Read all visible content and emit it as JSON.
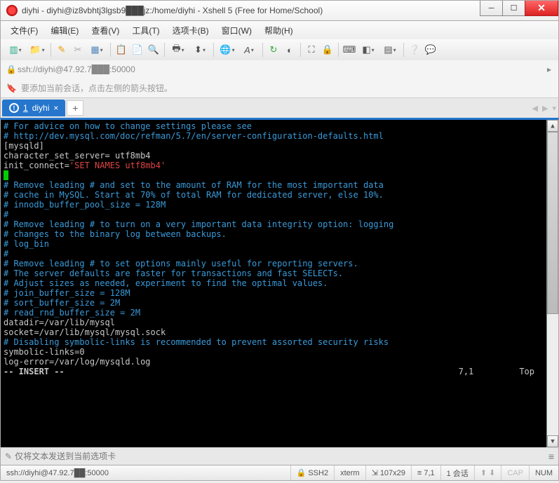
{
  "window": {
    "title": "diyhi - diyhi@iz8vbhtj3lgsb9███jz:/home/diyhi - Xshell 5 (Free for Home/School)"
  },
  "menu": {
    "file": "文件(F)",
    "edit": "编辑(E)",
    "view": "查看(V)",
    "tools": "工具(T)",
    "tabs": "选项卡(B)",
    "window": "窗口(W)",
    "help": "帮助(H)"
  },
  "address": {
    "value": "ssh://diyhi@47.92.7███:50000"
  },
  "hint": {
    "text": "要添加当前会话，点击左侧的箭头按钮。"
  },
  "tab": {
    "num": "1",
    "name": "diyhi"
  },
  "term": {
    "l1": "# For advice on how to change settings please see",
    "l2": "# http://dev.mysql.com/doc/refman/5.7/en/server-configuration-defaults.html",
    "l3": "",
    "l4": "[mysqld]",
    "l5": "character_set_server= utf8mb4",
    "l6a": "init_connect=",
    "l6b": "'SET NAMES utf8mb4'",
    "l7": "#",
    "l8": "# Remove leading # and set to the amount of RAM for the most important data",
    "l9": "# cache in MySQL. Start at 70% of total RAM for dedicated server, else 10%.",
    "l10": "# innodb_buffer_pool_size = 128M",
    "l11": "#",
    "l12": "# Remove leading # to turn on a very important data integrity option: logging",
    "l13": "# changes to the binary log between backups.",
    "l14": "# log_bin",
    "l15": "#",
    "l16": "# Remove leading # to set options mainly useful for reporting servers.",
    "l17": "# The server defaults are faster for transactions and fast SELECTs.",
    "l18": "# Adjust sizes as needed, experiment to find the optimal values.",
    "l19": "# join_buffer_size = 128M",
    "l20": "# sort_buffer_size = 2M",
    "l21": "# read_rnd_buffer_size = 2M",
    "l22": "datadir=/var/lib/mysql",
    "l23": "socket=/var/lib/mysql/mysql.sock",
    "l24": "",
    "l25": "# Disabling symbolic-links is recommended to prevent assorted security risks",
    "l26": "symbolic-links=0",
    "l27": "",
    "l28": "log-error=/var/log/mysqld.log",
    "l29a": "-- INSERT --",
    "l29b": "7,1",
    "l29c": "Top"
  },
  "input": {
    "placeholder": "仅将文本发送到当前选项卡"
  },
  "status": {
    "conn": "ssh://diyhi@47.92.7██:50000",
    "ssh": "SSH2",
    "term": "xterm",
    "size": "107x29",
    "pos": "7,1",
    "sess": "1 会话",
    "cap": "CAP",
    "num": "NUM"
  }
}
